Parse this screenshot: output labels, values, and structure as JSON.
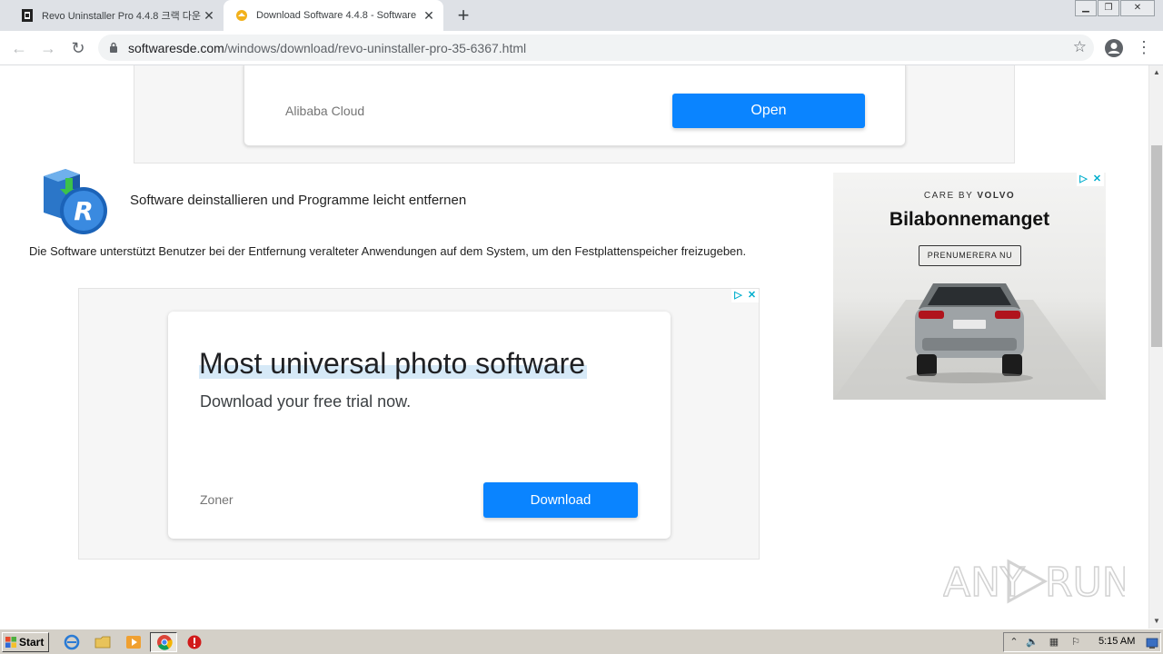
{
  "browser": {
    "tabs": [
      {
        "title": "Revo Uninstaller Pro 4.4.8 크랙 다운",
        "active": false
      },
      {
        "title": "Download Software 4.4.8 - Software",
        "active": true
      }
    ],
    "new_tab_label": "+",
    "url_domain": "softwaresde.com",
    "url_path": "/windows/download/revo-uninstaller-pro-35-6367.html"
  },
  "ad_top": {
    "brand": "Alibaba Cloud",
    "button": "Open"
  },
  "article": {
    "tagline": "Software deinstallieren und Programme leicht entfernen",
    "description": "Die Software unterstützt Benutzer bei der Entfernung veralteter Anwendungen auf dem System, um den Festplattenspeicher freizugeben."
  },
  "ad_main": {
    "headline": "Most universal photo software",
    "subline": "Download your free trial now.",
    "brand": "Zoner",
    "button": "Download"
  },
  "ad_side": {
    "kicker_prefix": "CARE BY",
    "kicker_brand": "VOLVO",
    "title": "Bilabonnemanget",
    "cta": "PRENUMERERA NU"
  },
  "watermark": "ANY RUN",
  "taskbar": {
    "start_label": "Start",
    "clock": "5:15 AM"
  },
  "colors": {
    "ad_button_blue": "#0a84ff",
    "adchoices_cyan": "#00aecd",
    "taskbar_gray": "#d4d0c8"
  }
}
